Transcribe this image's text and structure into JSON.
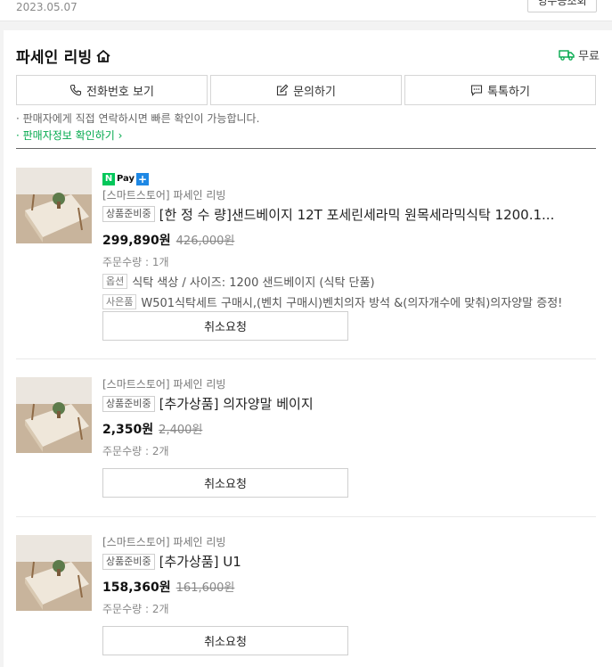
{
  "top": {
    "date": "2023.05.07",
    "button_label": "영수증조회"
  },
  "seller": {
    "name": "파세인 리빙",
    "shipping_label": "무료",
    "shipping_color": "#03a94d"
  },
  "actions": [
    {
      "label": "전화번호 보기",
      "icon": "phone-icon"
    },
    {
      "label": "문의하기",
      "icon": "edit-icon"
    },
    {
      "label": "톡톡하기",
      "icon": "chat-icon"
    }
  ],
  "notice": {
    "line1": "· 판매자에게 직접 연락하시면 빠른 확인이 가능합니다.",
    "link": "· 판매자정보 확인하기 ›"
  },
  "pay_badge": {
    "n": "N",
    "text": "Pay",
    "plus": "+"
  },
  "items": [
    {
      "store": "[스마트스토어] 파세인 리빙",
      "status": "상품준비중",
      "title": "[한 정 수 량]샌드베이지 12T 포세린세라믹 원목세라믹식탁 1200.1...",
      "price": "299,890원",
      "orig_price": "426,000원",
      "qty": "주문수량 : 1개",
      "option_tag": "옵션",
      "option": "식탁 색상 / 사이즈: 1200 샌드베이지 (식탁 단품)",
      "gift_tag": "사은품",
      "gift": "W501식탁세트 구매시,(벤치 구매시)벤치의자 방석 &(의자개수에 맞춰)의자양말 증정!",
      "cancel": "취소요청"
    },
    {
      "store": "[스마트스토어] 파세인 리빙",
      "status": "상품준비중",
      "title": "[추가상품] 의자양말 베이지",
      "price": "2,350원",
      "orig_price": "2,400원",
      "qty": "주문수량 : 2개",
      "cancel": "취소요청"
    },
    {
      "store": "[스마트스토어] 파세인 리빙",
      "status": "상품준비중",
      "title": "[추가상품] U1",
      "price": "158,360원",
      "orig_price": "161,600원",
      "qty": "주문수량 : 2개",
      "cancel": "취소요청"
    }
  ]
}
